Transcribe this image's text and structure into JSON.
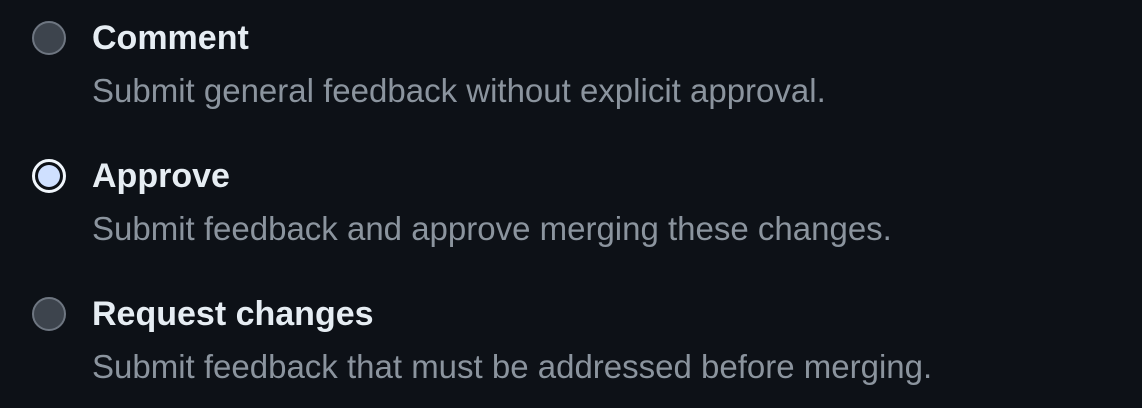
{
  "review_options": [
    {
      "label": "Comment",
      "description": "Submit general feedback without explicit approval.",
      "selected": false
    },
    {
      "label": "Approve",
      "description": "Submit feedback and approve merging these changes.",
      "selected": true
    },
    {
      "label": "Request changes",
      "description": "Submit feedback that must be addressed before merging.",
      "selected": false
    }
  ],
  "colors": {
    "background": "#0d1117",
    "label": "#e6edf3",
    "description": "#8b949e",
    "radio_selected_fill": "#cfe0ff"
  }
}
